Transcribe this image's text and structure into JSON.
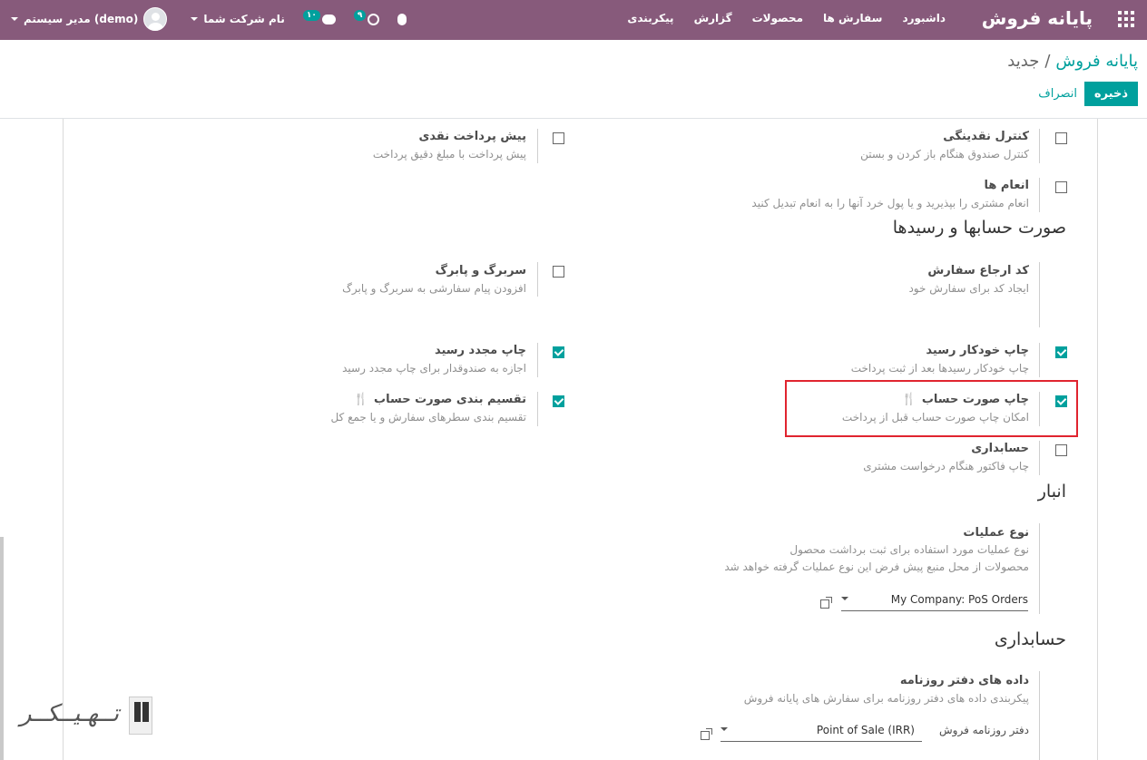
{
  "topbar": {
    "brand": "پایانه فروش",
    "menu": [
      "داشبورد",
      "سفارش ها",
      "محصولات",
      "گزارش",
      "پیکربندی"
    ],
    "chat_badge": "۱۰",
    "activity_badge": "۹",
    "company": "نام شرکت شما",
    "user": "مدیر سیستم (demo)"
  },
  "breadcrumb": {
    "parent": "پایانه فروش",
    "sep": "/",
    "current": "جدید"
  },
  "buttons": {
    "save": "ذخیره",
    "discard": "انصراف"
  },
  "settings": {
    "cash_control": {
      "title": "کنترل نقدینگی",
      "desc": "کنترل صندوق هنگام باز کردن و بستن",
      "checked": false
    },
    "cash_prepay": {
      "title": "پیش پرداخت نقدی",
      "desc": "پیش پرداخت با مبلغ دقیق پرداخت",
      "checked": false
    },
    "tips": {
      "title": "انعام ها",
      "desc": "انعام مشتری را بپذیرید و یا پول خرد آنها را به انعام تبدیل کنید",
      "checked": false
    },
    "order_ref": {
      "title": "کد ارجاع سفارش",
      "desc": "ایجاد کد برای سفارش خود"
    },
    "header_footer": {
      "title": "سربرگ و پابرگ",
      "desc": "افزودن پیام سفارشی به سربرگ و پابرگ",
      "checked": false
    },
    "auto_print": {
      "title": "چاپ خودکار رسید",
      "desc": "چاپ خودکار رسیدها بعد از ثبت پرداخت",
      "checked": true
    },
    "reprint": {
      "title": "چاپ مجدد رسید",
      "desc": "اجازه به صندوقدار برای چاپ مجدد رسید",
      "checked": true
    },
    "bill_print": {
      "title": "چاپ صورت حساب",
      "desc": "امکان چاپ صورت حساب قبل از پرداخت",
      "checked": true
    },
    "bill_split": {
      "title": "تقسیم بندی صورت حساب",
      "desc": "تقسیم بندی سطرهای سفارش و یا جمع کل",
      "checked": true
    },
    "invoicing": {
      "title": "حسابداری",
      "desc": "چاپ فاکتور هنگام درخواست مشتری",
      "checked": false
    },
    "operation_type": {
      "title": "نوع عملیات",
      "desc1": "نوع عملیات مورد استفاده برای ثبت برداشت محصول",
      "desc2": "محصولات از محل منبع پیش فرض این نوع عملیات گرفته خواهد شد",
      "value": "My Company: PoS Orders"
    },
    "journal_data": {
      "title": "داده های دفتر روزنامه",
      "desc": "پیکربندی داده های دفتر روزنامه برای سفارش های پایانه فروش",
      "label": "دفتر روزنامه فروش",
      "value": "Point of Sale (IRR)"
    }
  },
  "sections": {
    "bills": "صورت حسابها و رسیدها",
    "inventory": "انبار",
    "accounting": "حسابداری"
  },
  "icons": {
    "fork": "🍴"
  },
  "watermark": "تــهـیــکــر"
}
